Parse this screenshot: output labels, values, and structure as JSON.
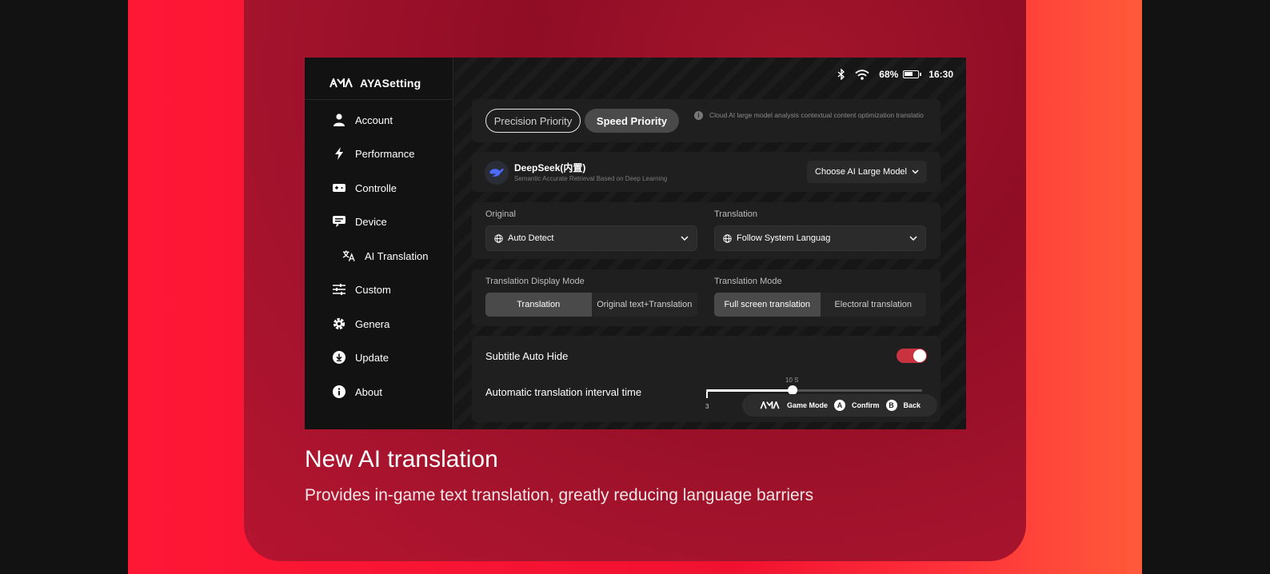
{
  "hero": {
    "title": "New AI translation",
    "subtitle": "Provides in-game text translation, greatly reducing language barriers"
  },
  "app": {
    "brand": "AYASetting"
  },
  "status": {
    "battery": "68%",
    "battery_level": 0.68,
    "time": "16:30"
  },
  "sidebar": {
    "items": [
      {
        "label": "Account",
        "icon": "user-icon"
      },
      {
        "label": "Performance",
        "icon": "lightning-icon"
      },
      {
        "label": "Controlle",
        "icon": "gamepad-icon"
      },
      {
        "label": "Device",
        "icon": "device-icon"
      },
      {
        "label": "AI Translation",
        "icon": "translate-icon"
      },
      {
        "label": "Custom",
        "icon": "sliders-icon"
      },
      {
        "label": "Genera",
        "icon": "gear-icon"
      },
      {
        "label": "Update",
        "icon": "download-icon"
      },
      {
        "label": "About",
        "icon": "info-icon"
      }
    ]
  },
  "priority": {
    "precision": "Precision Priority",
    "speed": "Speed Priority",
    "selected": "Speed Priority",
    "info": "Cloud AI large model analysis contextual content optimization translatio"
  },
  "model": {
    "name": "DeepSeek(内置)",
    "desc": "Semantic Accurate Retrieval Based on Deep Learning",
    "choose": "Choose AI Large Model"
  },
  "languages": {
    "original_label": "Original",
    "original_value": "Auto Detect",
    "translation_label": "Translation",
    "translation_value": "Follow System Languag"
  },
  "display_mode": {
    "label": "Translation Display Mode",
    "options": [
      "Translation",
      "Original text+Translation"
    ],
    "selected": "Translation"
  },
  "translation_mode": {
    "label": "Translation Mode",
    "options": [
      "Full screen translation",
      "Electoral translation"
    ],
    "selected": "Full screen translation"
  },
  "subtitle": {
    "label": "Subtitle Auto Hide",
    "on": true
  },
  "interval": {
    "label": "Automatic translation interval time",
    "value_label": "10 S",
    "min_label": "3",
    "fraction": 0.4
  },
  "hints": {
    "game_mode": "Game Mode",
    "a_key": "A",
    "confirm": "Confirm",
    "b_key": "B",
    "back": "Back"
  },
  "colors": {
    "accent": "#c8333f",
    "band": "#f0112f",
    "card": "#8f0d25"
  }
}
